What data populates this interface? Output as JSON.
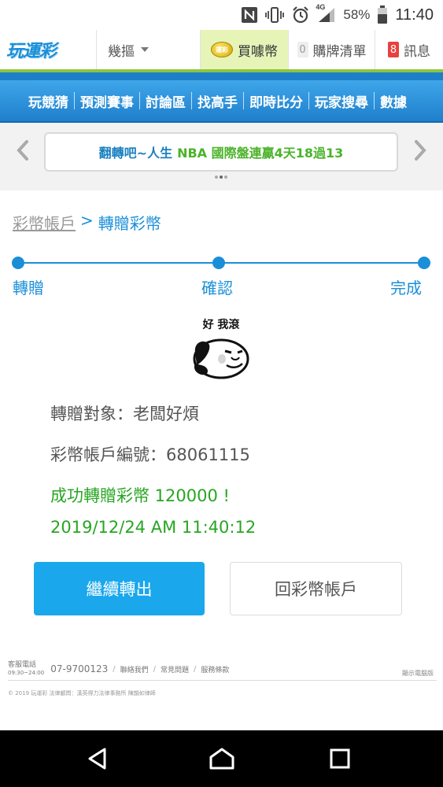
{
  "status_bar": {
    "battery_percent": "58%",
    "time": "11:40",
    "network": "4G",
    "icons": [
      "nfc-icon",
      "vibrate-icon",
      "alarm-icon",
      "signal-icon",
      "battery-icon"
    ]
  },
  "top_nav": {
    "logo_text": "玩運彩",
    "dropdown_label": "幾摳",
    "buy_coin_label": "買噱幣",
    "coin_icon_text": "運彩",
    "list_count": "0",
    "list_label": "購牌清單",
    "message_count": "8",
    "message_label": "訊息"
  },
  "menu": {
    "items": [
      "玩競猜",
      "預測賽事",
      "討論區",
      "找高手",
      "即時比分",
      "玩家搜尋",
      "數據"
    ]
  },
  "ticker": {
    "text_blue": "翻轉吧~人生",
    "text_green": "NBA 國際盤連贏4天18過13"
  },
  "breadcrumb": {
    "parent": "彩幣帳戶",
    "separator": ">",
    "current": "轉贈彩幣"
  },
  "steps": [
    "轉贈",
    "確認",
    "完成"
  ],
  "meme": {
    "caption": "好 我滾"
  },
  "result": {
    "recipient_line": "轉贈對象：老闆好煩",
    "account_line": "彩幣帳戶編號：68061115",
    "success_line": "成功轉贈彩幣 120000 !",
    "timestamp": "2019/12/24 AM 11:40:12"
  },
  "buttons": {
    "continue_label": "繼續轉出",
    "back_label": "回彩幣帳戶"
  },
  "footer": {
    "service_label": "客服電話",
    "service_hours": "09:30~24:00",
    "phone": "07-9700123",
    "links": [
      "聯絡我們",
      "常見問題",
      "服務條款"
    ],
    "right_link": "顯示電腦版",
    "copyright": "© 2019 玩運彩  法律顧問：漢英得力法律事務所 陳韻如律師"
  },
  "colors": {
    "brand_blue": "#1a8fd8",
    "accent_green": "#27a622",
    "button_blue": "#1aa7ec",
    "menu_blue": "#2b8fdb",
    "lime": "#8cc63f"
  }
}
